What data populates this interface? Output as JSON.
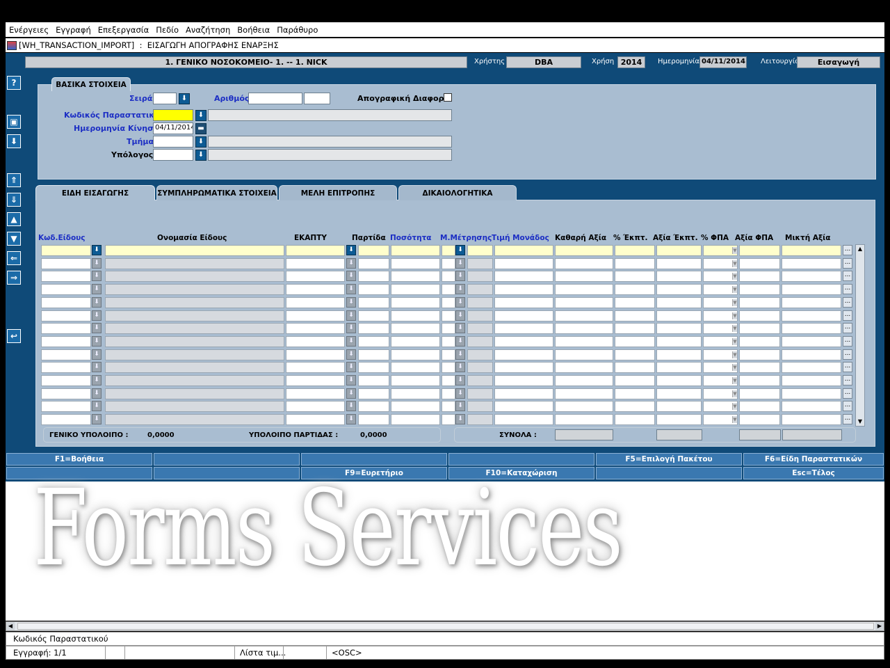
{
  "menu": {
    "items": [
      "Ενέργειες",
      "Εγγραφή",
      "Επεξεργασία",
      "Πεδίο",
      "Αναζήτηση",
      "Βοήθεια",
      "Παράθυρο"
    ]
  },
  "window": {
    "title": "[WH_TRANSACTION_IMPORT]  :  ΕΙΣΑΓΩΓΗ ΑΠΟΓΡΑΦΗΣ ΕΝΑΡΞΗΣ"
  },
  "header": {
    "organization": "1. ΓΕΝΙΚΟ ΝΟΣΟΚΟΜΕΙΟ- 1. -- 1. NICK",
    "user_label": "Χρήστης",
    "user_value": "DBA",
    "year_label": "Χρήση",
    "year_value": "2014",
    "date_label": "Ημερομηνία",
    "date_value": "04/11/2014",
    "mode_label": "Λειτουργία",
    "mode_value": "Εισαγωγή"
  },
  "basic": {
    "title": "ΒΑΣΙΚΑ ΣΤΟΙΧΕΙΑ",
    "series_label": "Σειρά",
    "series_value": "",
    "number_label": "Αριθμός",
    "number_value": "",
    "number_value2": "",
    "inventory_diff_label": "Απογραφική Διαφορά",
    "inventory_diff_checked": false,
    "doc_code_label": "Κωδικός Παραστατικού",
    "doc_code_value": "",
    "doc_code_desc": "",
    "move_date_label": "Ημερομηνία Κίνησης",
    "move_date_value": "04/11/2014",
    "dept_label": "Τμήμα",
    "dept_value": "",
    "dept_desc": "",
    "accountable_label": "Υπόλογος",
    "accountable_value": "",
    "accountable_desc": ""
  },
  "tabs": [
    "ΕΙΔΗ ΕΙΣΑΓΩΓΗΣ",
    "ΣΥΜΠΛΗΡΩΜΑΤΙΚΑ ΣΤΟΙΧΕΙΑ",
    "ΜΕΛΗ ΕΠΙΤΡΟΠΗΣ",
    "ΔΙΚΑΙΟΛΟΓΗΤΙΚΑ"
  ],
  "grid": {
    "columns": [
      "Κωδ.Είδους",
      "Ονομασία Είδους",
      "ΕΚΑΠΤΥ",
      "Παρτίδα",
      "Ποσότητα",
      "Μ.Μέτρησης",
      "Τιμή Μονάδος",
      "Καθαρή Αξία",
      "% Έκπτ.",
      "Αξία Έκπτ.",
      "% ΦΠΑ",
      "Αξία  ΦΠΑ",
      "Μικτή Αξία"
    ],
    "row_count": 14
  },
  "footer": {
    "general_balance_label": "ΓΕΝΙΚΟ ΥΠΟΛΟΙΠΟ :",
    "general_balance_value": "0,0000",
    "batch_balance_label": "ΥΠΟΛΟΙΠΟ ΠΑΡΤΙΔΑΣ :",
    "batch_balance_value": "0,0000",
    "totals_label": "ΣΥΝΟΛΑ :"
  },
  "fkeys": {
    "row1": [
      "F1=Βοήθεια",
      "",
      "",
      "",
      "F5=Επιλογή Πακέτου",
      "F6=Είδη Παραστατικών"
    ],
    "row2": [
      "",
      "",
      "F9=Ευρετήριο",
      "F10=Καταχώριση",
      "",
      "Esc=Τέλος"
    ]
  },
  "watermark": "Forms Services",
  "status": {
    "hint": "Κωδικός Παραστατικού",
    "record": "Εγγραφή: 1/1",
    "list": "Λίστα τιμ...",
    "osc": "<OSC>"
  },
  "colors": {
    "app_bg": "#0f4a78",
    "canvas": "#a9bdd1",
    "required_field": "#ffff00",
    "fkey": "#3a78b0",
    "label_blue": "#1c2ec4"
  }
}
